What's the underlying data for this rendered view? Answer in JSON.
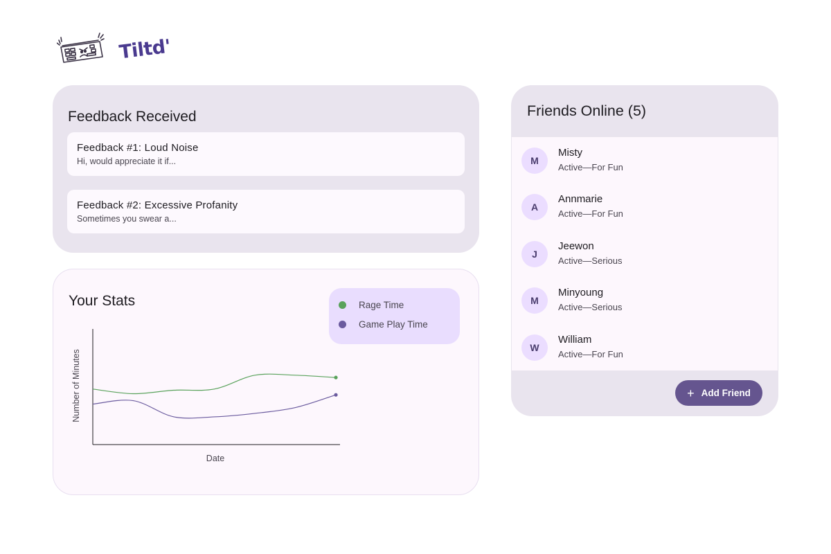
{
  "brand": {
    "name": "Tiltd'",
    "logo_icon": "angry-keyboard-icon"
  },
  "feedback": {
    "title": "Feedback Received",
    "items": [
      {
        "title": "Feedback #1: Loud Noise",
        "preview": "Hi, would appreciate it if..."
      },
      {
        "title": "Feedback #2: Excessive Profanity",
        "preview": "Sometimes you swear a..."
      }
    ]
  },
  "stats": {
    "title": "Your Stats",
    "legend": [
      {
        "label": "Rage Time",
        "color": "#59a25b"
      },
      {
        "label": "Game Play Time",
        "color": "#6a5a9e"
      }
    ]
  },
  "chart_data": {
    "type": "line",
    "title": "Your Stats",
    "xlabel": "Date",
    "ylabel": "Number of Minutes",
    "x": [
      0,
      1,
      2,
      3,
      4,
      5,
      6
    ],
    "ylim": [
      0,
      10
    ],
    "grid": false,
    "legend_position": "top-right",
    "series": [
      {
        "name": "Rage Time",
        "color": "#59a25b",
        "values": [
          4.8,
          4.4,
          4.7,
          4.8,
          6.0,
          6.0,
          5.8
        ]
      },
      {
        "name": "Game Play Time",
        "color": "#6a5a9e",
        "values": [
          3.5,
          3.8,
          2.4,
          2.4,
          2.7,
          3.2,
          4.3
        ]
      }
    ]
  },
  "friends": {
    "title": "Friends Online (5)",
    "list": [
      {
        "initial": "M",
        "name": "Misty",
        "status": "Active—For Fun"
      },
      {
        "initial": "A",
        "name": "Annmarie",
        "status": "Active—For Fun"
      },
      {
        "initial": "J",
        "name": "Jeewon",
        "status": "Active—Serious"
      },
      {
        "initial": "M",
        "name": "Minyoung",
        "status": "Active—Serious"
      },
      {
        "initial": "W",
        "name": "William",
        "status": "Active—For Fun"
      }
    ],
    "add_button": {
      "label": "Add Friend",
      "icon": "plus-icon"
    }
  }
}
